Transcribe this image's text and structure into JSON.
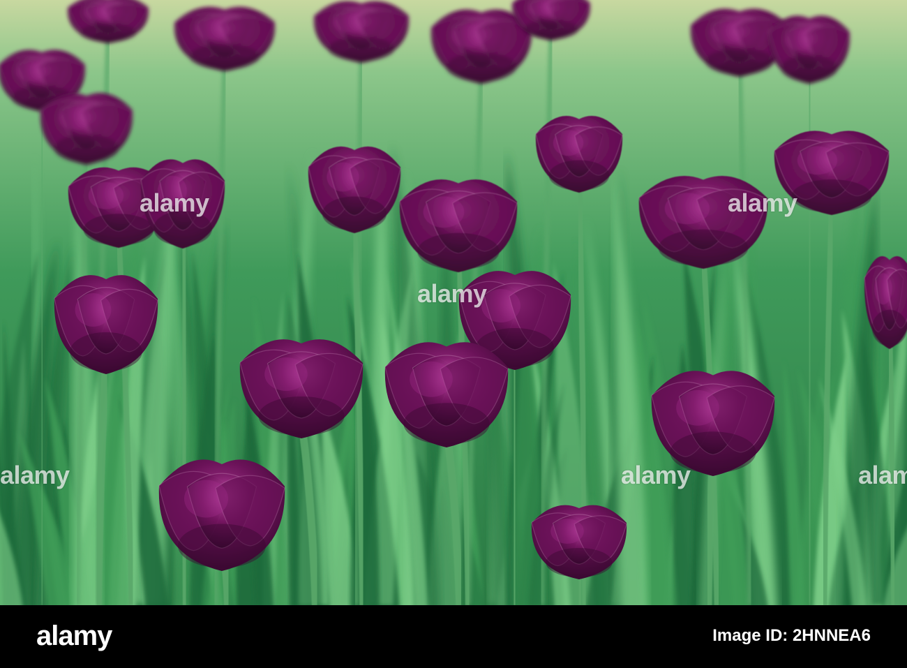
{
  "photo": {
    "subject": "purple-tulips",
    "colors": {
      "petal_dark": "#3a0830",
      "petal_mid": "#6a1258",
      "petal_light": "#a02a8a",
      "leaf_dark": "#1f6a3a",
      "leaf_light": "#7fd08a",
      "stem": "#5aa86a"
    }
  },
  "watermark": {
    "text": "alamy"
  },
  "footer": {
    "logo": "alamy",
    "label": "Image ID: 2HNNEA6"
  }
}
